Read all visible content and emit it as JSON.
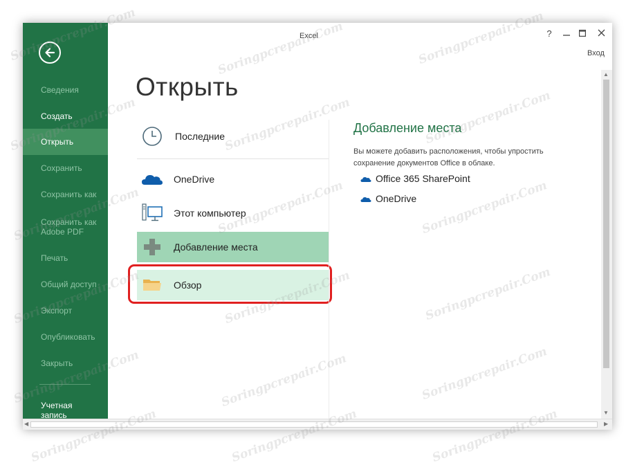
{
  "window": {
    "title": "Excel",
    "help": "?",
    "signin": "Вход"
  },
  "sidebar": {
    "items": [
      {
        "label": "Сведения",
        "state": "disabled"
      },
      {
        "label": "Создать",
        "state": "enabled"
      },
      {
        "label": "Открыть",
        "state": "selected"
      },
      {
        "label": "Сохранить",
        "state": "disabled"
      },
      {
        "label": "Сохранить как",
        "state": "disabled"
      },
      {
        "label": "Сохранить как",
        "label2": "Adobe PDF",
        "state": "disabled"
      },
      {
        "label": "Печать",
        "state": "disabled"
      },
      {
        "label": "Общий доступ",
        "state": "disabled"
      },
      {
        "label": "Экспорт",
        "state": "disabled"
      },
      {
        "label": "Опубликовать",
        "state": "disabled"
      },
      {
        "label": "Закрыть",
        "state": "disabled"
      },
      {
        "label": "Учетная",
        "label2": "запись",
        "state": "enabled"
      }
    ]
  },
  "main": {
    "title": "Открыть",
    "places": [
      {
        "label": "Последние",
        "icon": "clock-icon"
      },
      {
        "label": "OneDrive",
        "icon": "cloud-icon"
      },
      {
        "label": "Этот компьютер",
        "icon": "computer-icon"
      },
      {
        "label": "Добавление места",
        "icon": "plus-icon",
        "state": "selected"
      },
      {
        "label": "Обзор",
        "icon": "folder-icon",
        "state": "highlighted"
      }
    ]
  },
  "right_panel": {
    "title": "Добавление места",
    "description": "Вы можете добавить расположения, чтобы упростить сохранение документов Office в облаке.",
    "links": [
      {
        "label": "Office 365 SharePoint",
        "icon": "cloud-icon"
      },
      {
        "label": "OneDrive",
        "icon": "cloud-icon"
      }
    ]
  },
  "watermark": "Soringpcrepair.Com",
  "colors": {
    "sidebar": "#217346",
    "sidebar_selected": "#41905f",
    "accent": "#217346",
    "add_place_bg": "#9fd5b5",
    "browse_bg": "#d9f2e3",
    "highlight_border": "#e02020",
    "onedrive_blue": "#0f5dab"
  }
}
